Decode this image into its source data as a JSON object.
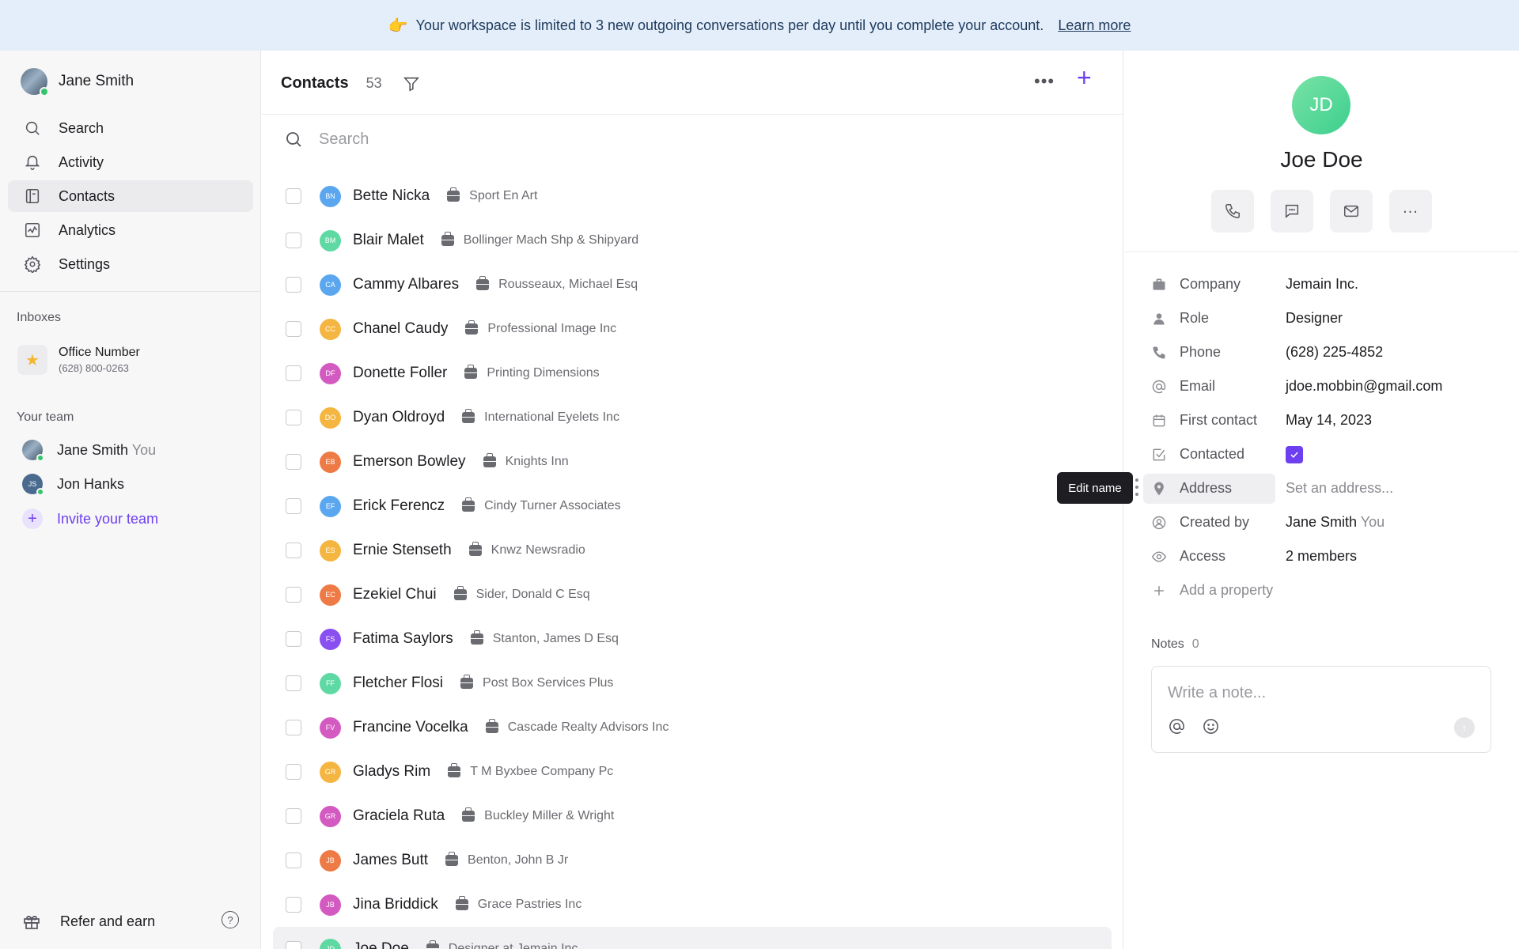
{
  "banner": {
    "icon": "👉",
    "text": "Your workspace is limited to 3 new outgoing conversations per day until you complete your account.",
    "link": "Learn more"
  },
  "sidebar": {
    "user": "Jane Smith",
    "nav": [
      {
        "label": "Search",
        "icon": "search-icon"
      },
      {
        "label": "Activity",
        "icon": "bell-icon"
      },
      {
        "label": "Contacts",
        "icon": "contacts-icon",
        "active": true
      },
      {
        "label": "Analytics",
        "icon": "analytics-icon"
      },
      {
        "label": "Settings",
        "icon": "gear-icon"
      }
    ],
    "inboxes_label": "Inboxes",
    "inbox": {
      "title": "Office Number",
      "number": "(628) 800-0263"
    },
    "team_label": "Your team",
    "team": [
      {
        "name": "Jane Smith",
        "suffix": "You"
      },
      {
        "name": "Jon Hanks",
        "initials": "JS"
      }
    ],
    "invite": "Invite your team",
    "refer": "Refer and earn",
    "help": "?"
  },
  "contacts": {
    "title": "Contacts",
    "count": "53",
    "search_placeholder": "Search",
    "rows": [
      {
        "initials": "BN",
        "name": "Bette Nicka",
        "company": "Sport En Art",
        "color": "#5aa7f0"
      },
      {
        "initials": "BM",
        "name": "Blair Malet",
        "company": "Bollinger Mach Shp & Shipyard",
        "color": "#5fd9a4"
      },
      {
        "initials": "CA",
        "name": "Cammy Albares",
        "company": "Rousseaux, Michael Esq",
        "color": "#5aa7f0"
      },
      {
        "initials": "CC",
        "name": "Chanel Caudy",
        "company": "Professional Image Inc",
        "color": "#f5b541"
      },
      {
        "initials": "DF",
        "name": "Donette Foller",
        "company": "Printing Dimensions",
        "color": "#d35ac0"
      },
      {
        "initials": "DO",
        "name": "Dyan Oldroyd",
        "company": "International Eyelets Inc",
        "color": "#f5b541"
      },
      {
        "initials": "EB",
        "name": "Emerson Bowley",
        "company": "Knights Inn",
        "color": "#ee7a45"
      },
      {
        "initials": "EF",
        "name": "Erick Ferencz",
        "company": "Cindy Turner Associates",
        "color": "#5aa7f0"
      },
      {
        "initials": "ES",
        "name": "Ernie Stenseth",
        "company": "Knwz Newsradio",
        "color": "#f5b541"
      },
      {
        "initials": "EC",
        "name": "Ezekiel Chui",
        "company": "Sider, Donald C Esq",
        "color": "#ee7a45"
      },
      {
        "initials": "FS",
        "name": "Fatima Saylors",
        "company": "Stanton, James D Esq",
        "color": "#8a4ff0"
      },
      {
        "initials": "FF",
        "name": "Fletcher Flosi",
        "company": "Post Box Services Plus",
        "color": "#5fd9a4"
      },
      {
        "initials": "FV",
        "name": "Francine Vocelka",
        "company": "Cascade Realty Advisors Inc",
        "color": "#d35ac0"
      },
      {
        "initials": "GR",
        "name": "Gladys Rim",
        "company": "T M Byxbee Company Pc",
        "color": "#f5b541"
      },
      {
        "initials": "GR",
        "name": "Graciela Ruta",
        "company": "Buckley Miller & Wright",
        "color": "#d35ac0"
      },
      {
        "initials": "JB",
        "name": "James Butt",
        "company": "Benton, John B Jr",
        "color": "#ee7a45"
      },
      {
        "initials": "JB",
        "name": "Jina Briddick",
        "company": "Grace Pastries Inc",
        "color": "#d35ac0"
      },
      {
        "initials": "JD",
        "name": "Joe Doe",
        "company": "Designer at Jemain Inc.",
        "color": "#5fd9a4",
        "selected": true
      }
    ]
  },
  "detail": {
    "initials": "JD",
    "name": "Joe Doe",
    "actions": [
      "phone-icon",
      "message-icon",
      "mail-icon",
      "more-icon"
    ],
    "props": [
      {
        "key": "Company",
        "value": "Jemain Inc.",
        "icon": "briefcase-icon"
      },
      {
        "key": "Role",
        "value": "Designer",
        "icon": "person-icon"
      },
      {
        "key": "Phone",
        "value": "(628) 225-4852",
        "icon": "phone-icon"
      },
      {
        "key": "Email",
        "value": "jdoe.mobbin@gmail.com",
        "icon": "at-icon"
      },
      {
        "key": "First contact",
        "value": "May 14, 2023",
        "icon": "calendar-icon"
      },
      {
        "key": "Contacted",
        "value": "",
        "icon": "checkbox-icon",
        "checked": true
      },
      {
        "key": "Address",
        "value": "Set an address...",
        "icon": "pin-icon",
        "placeholder": true
      },
      {
        "key": "Created by",
        "value": "Jane Smith",
        "suffix": "You",
        "icon": "user-circle-icon"
      },
      {
        "key": "Access",
        "value": "2 members",
        "icon": "eye-icon"
      }
    ],
    "add_property": "Add a property",
    "notes_label": "Notes",
    "notes_count": "0",
    "note_placeholder": "Write a note..."
  },
  "tooltip": "Edit name",
  "colors": {
    "accent": "#6d3ff0",
    "banner_bg": "#e3eefa"
  }
}
